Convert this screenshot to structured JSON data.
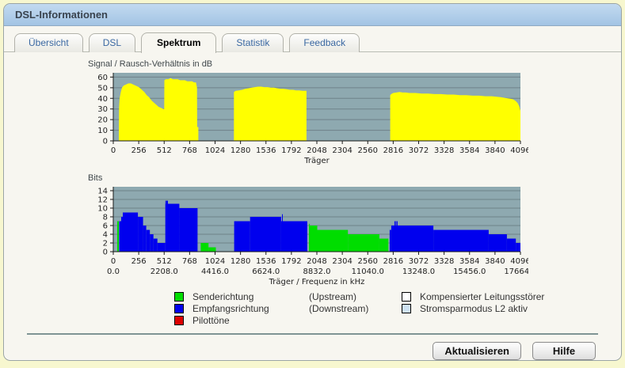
{
  "window": {
    "title": "DSL-Informationen"
  },
  "tabs": [
    {
      "label": "Übersicht",
      "active": false
    },
    {
      "label": "DSL",
      "active": false
    },
    {
      "label": "Spektrum",
      "active": true
    },
    {
      "label": "Statistik",
      "active": false
    },
    {
      "label": "Feedback",
      "active": false
    }
  ],
  "buttons": {
    "refresh": "Aktualisieren",
    "help": "Hilfe"
  },
  "legend": {
    "series": [
      {
        "label": "Senderichtung",
        "note": "(Upstream)"
      },
      {
        "label": "Empfangsrichtung",
        "note": "(Downstream)"
      },
      {
        "label": "Pilottöne",
        "note": ""
      }
    ],
    "flags": [
      {
        "label": "Kompensierter Leitungsstörer"
      },
      {
        "label": "Stromsparmodus L2 aktiv"
      }
    ]
  },
  "colors": {
    "plot_bg": "#8ea9b0",
    "grid": "#6f8289",
    "axis": "#1a1a1a",
    "snr": "#ffff00",
    "upstream": "#00dd00",
    "downstream": "#0000ee",
    "pilot": "#dd0000",
    "flag_white": "#ffffff",
    "flag_blue": "#cfe2f3"
  },
  "chart_data": [
    {
      "type": "area",
      "title": "Signal / Rausch-Verhältnis in dB",
      "xlabel": "Träger",
      "ylabel": "dB",
      "xlim": [
        0,
        4096
      ],
      "ylim": [
        0,
        60
      ],
      "xticks": [
        0,
        256,
        512,
        768,
        1024,
        1280,
        1536,
        1792,
        2048,
        2304,
        2560,
        2816,
        3072,
        3328,
        3584,
        3840,
        4096
      ],
      "yticks": [
        0,
        10,
        20,
        30,
        40,
        50,
        60
      ],
      "grid": true,
      "segments": [
        {
          "points": [
            [
              56,
              0
            ],
            [
              58,
              31
            ],
            [
              64,
              40
            ],
            [
              76,
              46
            ],
            [
              88,
              50
            ],
            [
              104,
              52
            ],
            [
              128,
              53
            ],
            [
              152,
              54
            ],
            [
              176,
              54
            ],
            [
              200,
              53
            ],
            [
              224,
              52
            ],
            [
              248,
              51
            ],
            [
              264,
              50
            ],
            [
              288,
              48
            ],
            [
              312,
              46
            ],
            [
              336,
              43
            ],
            [
              360,
              41
            ],
            [
              384,
              38
            ],
            [
              408,
              36
            ],
            [
              432,
              34
            ],
            [
              456,
              32
            ],
            [
              480,
              31
            ],
            [
              504,
              30
            ],
            [
              512,
              30
            ],
            [
              514,
              57
            ],
            [
              528,
              58
            ],
            [
              552,
              58
            ],
            [
              576,
              59
            ],
            [
              600,
              58
            ],
            [
              624,
              58
            ],
            [
              648,
              58
            ],
            [
              672,
              57
            ],
            [
              696,
              57
            ],
            [
              720,
              57
            ],
            [
              744,
              56
            ],
            [
              768,
              56
            ],
            [
              792,
              56
            ],
            [
              812,
              55
            ],
            [
              832,
              55
            ],
            [
              842,
              50
            ],
            [
              844,
              13
            ],
            [
              856,
              13
            ],
            [
              856,
              0
            ]
          ]
        },
        {
          "points": [
            [
              1214,
              0
            ],
            [
              1214,
              46
            ],
            [
              1232,
              47
            ],
            [
              1264,
              47.5
            ],
            [
              1296,
              48
            ],
            [
              1328,
              49
            ],
            [
              1360,
              49.5
            ],
            [
              1392,
              50
            ],
            [
              1424,
              50.5
            ],
            [
              1456,
              51
            ],
            [
              1488,
              51
            ],
            [
              1520,
              50.5
            ],
            [
              1552,
              50.5
            ],
            [
              1584,
              50
            ],
            [
              1616,
              50
            ],
            [
              1648,
              49.5
            ],
            [
              1680,
              49
            ],
            [
              1712,
              49
            ],
            [
              1744,
              48.5
            ],
            [
              1776,
              48
            ],
            [
              1808,
              48
            ],
            [
              1840,
              47.5
            ],
            [
              1872,
              47.5
            ],
            [
              1904,
              47
            ],
            [
              1944,
              47
            ],
            [
              1944,
              0
            ]
          ]
        },
        {
          "points": [
            [
              2786,
              0
            ],
            [
              2786,
              43
            ],
            [
              2796,
              44
            ],
            [
              2816,
              45
            ],
            [
              2848,
              45.5
            ],
            [
              2880,
              46
            ],
            [
              2912,
              45.5
            ],
            [
              2944,
              45.5
            ],
            [
              2976,
              45
            ],
            [
              3040,
              45
            ],
            [
              3104,
              44.5
            ],
            [
              3168,
              44.5
            ],
            [
              3232,
              44
            ],
            [
              3296,
              44
            ],
            [
              3360,
              43.5
            ],
            [
              3424,
              43.5
            ],
            [
              3488,
              43
            ],
            [
              3552,
              43
            ],
            [
              3616,
              42.5
            ],
            [
              3680,
              42.5
            ],
            [
              3744,
              42
            ],
            [
              3808,
              42
            ],
            [
              3856,
              41.5
            ],
            [
              3904,
              41
            ],
            [
              3936,
              40.5
            ],
            [
              3968,
              40
            ],
            [
              4000,
              39.5
            ],
            [
              4024,
              39
            ],
            [
              4048,
              37.5
            ],
            [
              4068,
              35.5
            ],
            [
              4082,
              33
            ],
            [
              4092,
              30
            ],
            [
              4096,
              28
            ],
            [
              4096,
              0
            ]
          ]
        }
      ]
    },
    {
      "type": "bar",
      "title": "Bits",
      "xlabel": "Träger / Frequenz in kHz",
      "ylabel": "Bits",
      "xlim": [
        0,
        4096
      ],
      "ylim": [
        0,
        14
      ],
      "xticks": [
        0,
        256,
        512,
        768,
        1024,
        1280,
        1536,
        1792,
        2048,
        2304,
        2560,
        2816,
        3072,
        3328,
        3584,
        3840,
        4096
      ],
      "freq_labels": [
        "0.0",
        "2208.0",
        "4416.0",
        "6624.0",
        "8832.0",
        "11040.0",
        "13248.0",
        "15456.0",
        "17664.0"
      ],
      "yticks": [
        0,
        2,
        4,
        6,
        8,
        10,
        12,
        14
      ],
      "grid": true,
      "steps": [
        [
          40,
          56,
          7,
          "up"
        ],
        [
          60,
          80,
          7,
          "down"
        ],
        [
          80,
          96,
          8,
          "down"
        ],
        [
          96,
          248,
          9,
          "down"
        ],
        [
          248,
          300,
          8,
          "down"
        ],
        [
          300,
          332,
          6,
          "down"
        ],
        [
          332,
          368,
          5,
          "down"
        ],
        [
          368,
          404,
          4,
          "down"
        ],
        [
          404,
          444,
          3,
          "down"
        ],
        [
          444,
          524,
          2,
          "down"
        ],
        [
          524,
          664,
          11,
          "down"
        ],
        [
          524,
          529,
          11.7,
          "down"
        ],
        [
          533,
          538,
          11.7,
          "down"
        ],
        [
          542,
          547,
          11.7,
          "down"
        ],
        [
          664,
          848,
          10,
          "down"
        ],
        [
          880,
          958,
          2,
          "up"
        ],
        [
          958,
          1032,
          1,
          "up"
        ],
        [
          1216,
          1376,
          7,
          "down"
        ],
        [
          1376,
          1688,
          8,
          "down"
        ],
        [
          1697,
          1703,
          8.6,
          "down"
        ],
        [
          1688,
          1952,
          7,
          "down"
        ],
        [
          1968,
          2052,
          6,
          "up"
        ],
        [
          1969,
          1975,
          6.4,
          "up"
        ],
        [
          2052,
          2360,
          5,
          "up"
        ],
        [
          2360,
          2676,
          4,
          "up"
        ],
        [
          2676,
          2768,
          3,
          "up"
        ],
        [
          2780,
          2796,
          5,
          "down"
        ],
        [
          2796,
          3220,
          6,
          "down"
        ],
        [
          2828,
          2833,
          7,
          "down"
        ],
        [
          2840,
          2846,
          7,
          "down"
        ],
        [
          2852,
          2858,
          7,
          "down"
        ],
        [
          3220,
          3776,
          5,
          "down"
        ],
        [
          3776,
          3960,
          4,
          "down"
        ],
        [
          3960,
          4050,
          3,
          "down"
        ],
        [
          4050,
          4096,
          2,
          "down"
        ]
      ]
    }
  ]
}
